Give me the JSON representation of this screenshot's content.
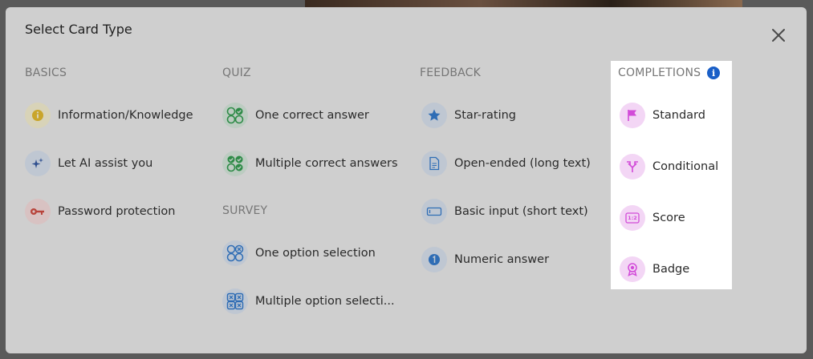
{
  "modal": {
    "title": "Select Card Type"
  },
  "basics": {
    "heading": "BASICS",
    "items": [
      {
        "label": "Information/Knowledge",
        "icon": "info-icon"
      },
      {
        "label": "Let AI assist you",
        "icon": "sparkles-icon"
      },
      {
        "label": "Password protection",
        "icon": "key-icon"
      }
    ]
  },
  "quiz": {
    "heading": "QUIZ",
    "items": [
      {
        "label": "One correct answer",
        "icon": "single-check-grid-icon"
      },
      {
        "label": "Multiple correct answers",
        "icon": "multi-check-grid-icon"
      }
    ]
  },
  "survey": {
    "heading": "SURVEY",
    "items": [
      {
        "label": "One option selection",
        "icon": "option-grid-icon"
      },
      {
        "label": "Multiple option selecti...",
        "icon": "multi-option-grid-icon"
      }
    ]
  },
  "feedback": {
    "heading": "FEEDBACK",
    "items": [
      {
        "label": "Star-rating",
        "icon": "star-icon"
      },
      {
        "label": "Open-ended (long text)",
        "icon": "document-icon"
      },
      {
        "label": "Basic input (short text)",
        "icon": "input-field-icon"
      },
      {
        "label": "Numeric answer",
        "icon": "number-one-icon"
      }
    ]
  },
  "completions": {
    "heading": "COMPLETIONS",
    "info_glyph": "i",
    "items": [
      {
        "label": "Standard",
        "icon": "flag-icon"
      },
      {
        "label": "Conditional",
        "icon": "split-arrow-icon"
      },
      {
        "label": "Score",
        "icon": "ratio-icon"
      },
      {
        "label": "Badge",
        "icon": "badge-icon"
      }
    ],
    "ratio_glyph": "1:2"
  },
  "colors": {
    "completions_accent": "#d24bd8",
    "info_accent": "#1a5fc7",
    "quiz_accent": "#2e8b47",
    "feedback_accent": "#2f6db5"
  }
}
